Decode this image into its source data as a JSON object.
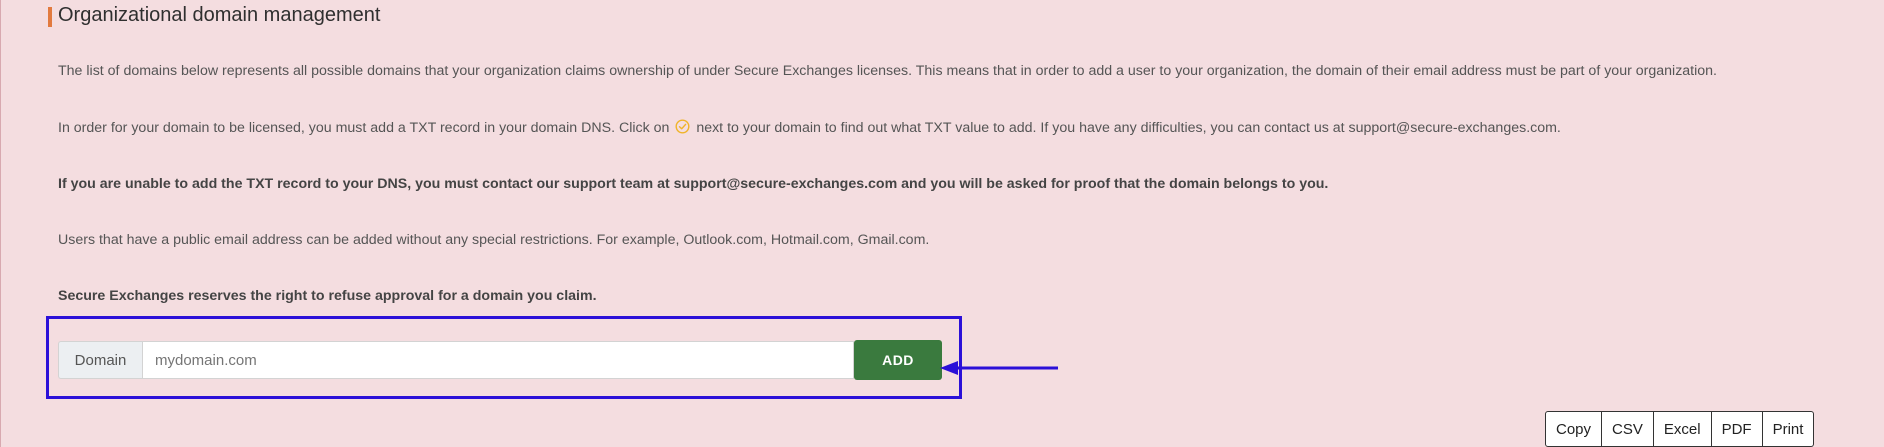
{
  "section": {
    "title": "Organizational domain management"
  },
  "paragraphs": {
    "p1": "The list of domains below represents all possible domains that your organization claims ownership of under Secure Exchanges licenses. This means that in order to add a user to your organization, the domain of their email address must be part of your organization.",
    "p2_before": "In order for your domain to be licensed, you must add a TXT record in your domain DNS. Click on",
    "p2_after": "next to your domain to find out what TXT value to add. If you have any difficulties, you can contact us at support@secure-exchanges.com.",
    "p3": "If you are unable to add the TXT record to your DNS, you must contact our support team at support@secure-exchanges.com and you will be asked for proof that the domain belongs to you.",
    "p4": "Users that have a public email address can be added without any special restrictions. For example, Outlook.com, Hotmail.com, Gmail.com.",
    "p5": "Secure Exchanges reserves the right to refuse approval for a domain you claim."
  },
  "icons": {
    "inline_check": "check-circle-icon",
    "arrow": "arrow-left-icon"
  },
  "domain_form": {
    "label": "Domain",
    "placeholder": "mydomain.com",
    "value": "",
    "add_label": "ADD"
  },
  "export": {
    "buttons": [
      "Copy",
      "CSV",
      "Excel",
      "PDF",
      "Print"
    ]
  },
  "colors": {
    "background": "#f4dde0",
    "accent_bar": "#e27a3f",
    "add_button": "#3a7a3e",
    "highlight_box": "#2b10d8",
    "check_icon": "#f0b429"
  }
}
